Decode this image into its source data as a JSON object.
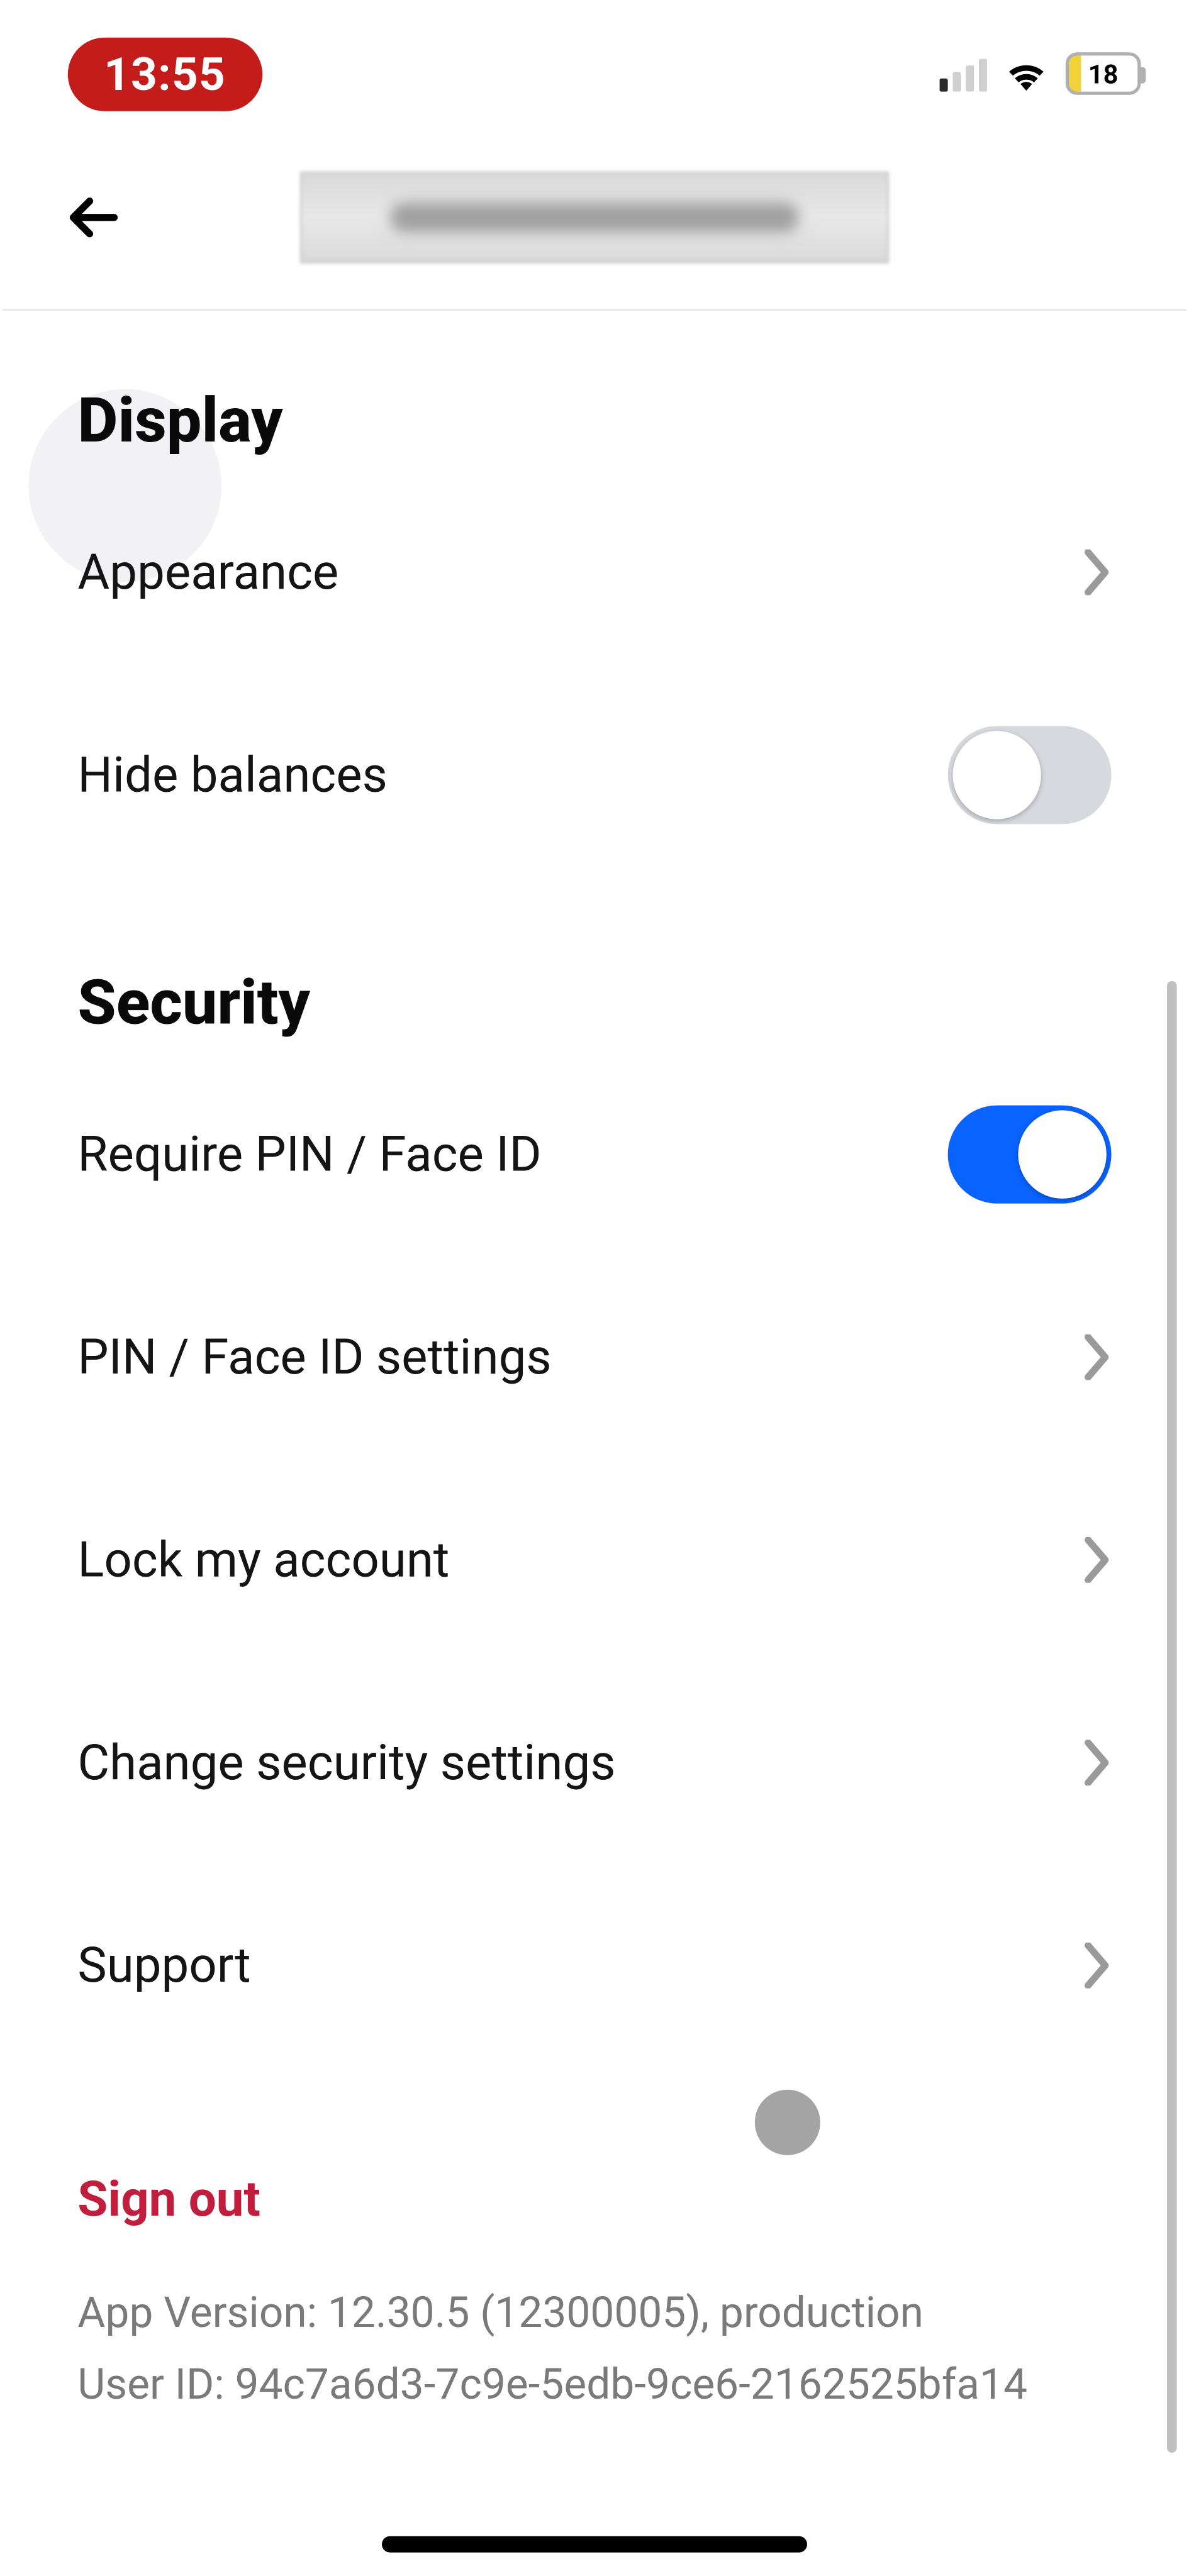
{
  "status_bar": {
    "time": "13:55",
    "battery_percent": "18"
  },
  "sections": {
    "display": {
      "heading": "Display",
      "appearance_label": "Appearance",
      "hide_balances_label": "Hide balances",
      "hide_balances_on": false
    },
    "security": {
      "heading": "Security",
      "require_pin_label": "Require PIN / Face ID",
      "require_pin_on": true,
      "pin_settings_label": "PIN / Face ID settings",
      "lock_account_label": "Lock my account",
      "change_security_label": "Change security settings",
      "support_label": "Support"
    }
  },
  "footer": {
    "signout_label": "Sign out",
    "app_version_line": "App Version: 12.30.5 (12300005), production",
    "user_id_line": "User ID: 94c7a6d3-7c9e-5edb-9ce6-2162525bfa14"
  },
  "colors": {
    "accent_red": "#c41b1b",
    "toggle_on": "#0a62ff",
    "signout_red": "#c11d3c"
  }
}
